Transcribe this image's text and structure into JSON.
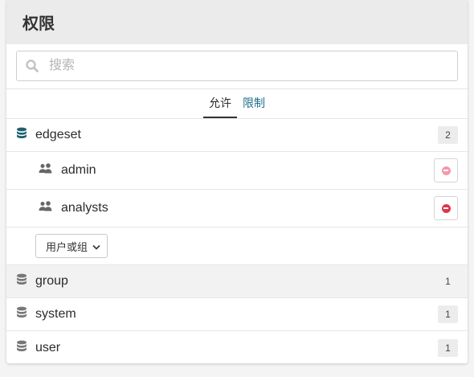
{
  "panel": {
    "title": "权限"
  },
  "search": {
    "placeholder": "搜索",
    "value": ""
  },
  "tabs": [
    {
      "label": "允许",
      "active": true
    },
    {
      "label": "限制",
      "active": false
    }
  ],
  "databases": [
    {
      "name": "edgeset",
      "count": "2",
      "icon": "database-icon",
      "color": "#1f5f73",
      "expanded": true,
      "principals": [
        {
          "name": "admin",
          "icon": "users-icon",
          "remove_color": "#f29aab"
        },
        {
          "name": "analysts",
          "icon": "users-icon",
          "remove_color": "#e0344f"
        }
      ],
      "add_select": {
        "label": "用户或组"
      }
    },
    {
      "name": "group",
      "count": "1",
      "icon": "database-icon",
      "color": "#777777",
      "highlighted": true
    },
    {
      "name": "system",
      "count": "1",
      "icon": "database-icon",
      "color": "#777777"
    },
    {
      "name": "user",
      "count": "1",
      "icon": "database-icon",
      "color": "#777777"
    }
  ],
  "colors": {
    "accent": "#1f6f8b",
    "danger": "#e0344f"
  }
}
